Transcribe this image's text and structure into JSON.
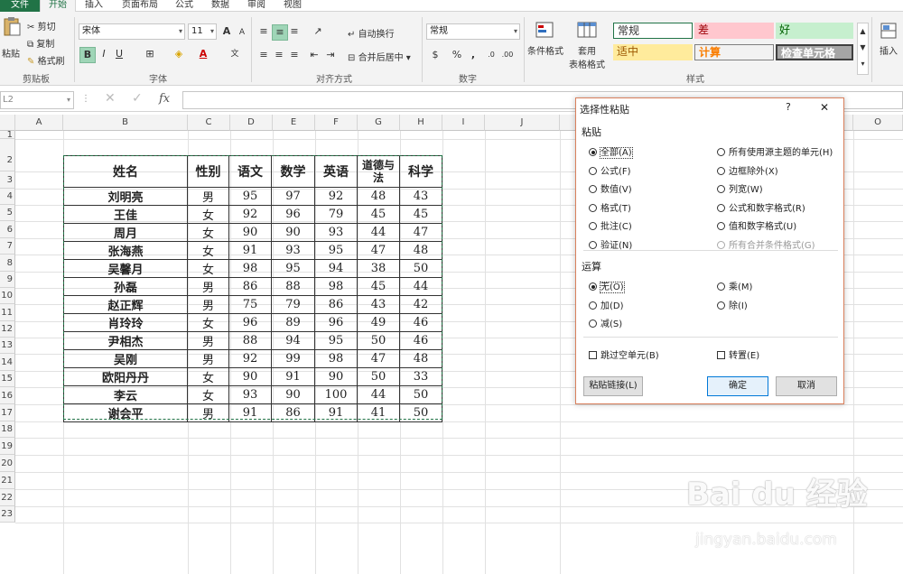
{
  "tabs": [
    "文件",
    "开始",
    "插入",
    "页面布局",
    "公式",
    "数据",
    "审阅",
    "视图"
  ],
  "clipboard": {
    "paste": "粘贴",
    "cut": "剪切",
    "copy": "复制",
    "format_painter": "格式刷",
    "label": "剪贴板"
  },
  "font": {
    "name": "宋体",
    "size": "11",
    "bold": "B",
    "italic": "I",
    "underline": "U",
    "label": "字体",
    "grow": "A",
    "shrink": "A"
  },
  "alignment": {
    "wrap": "自动换行",
    "merge": "合并后居中",
    "label": "对齐方式"
  },
  "number": {
    "format": "常规",
    "percent": "%",
    "comma": ",",
    "label": "数字"
  },
  "styles": {
    "cond_format": "条件格式",
    "table_format_1": "套用",
    "table_format_2": "表格格式",
    "normal": "常规",
    "bad": "差",
    "good": "好",
    "neutral": "适中",
    "calc": "计算",
    "check": "检查单元格",
    "label": "样式"
  },
  "cells": {
    "insert": "插入"
  },
  "formula_bar": {
    "name_box": "L2",
    "fx": "fx"
  },
  "columns": [
    "A",
    "B",
    "C",
    "D",
    "E",
    "F",
    "G",
    "H",
    "I",
    "J",
    "O"
  ],
  "rows": [
    "1",
    "2",
    "3",
    "4",
    "5",
    "6",
    "7",
    "8",
    "9",
    "10",
    "11",
    "12",
    "13",
    "14",
    "15",
    "16",
    "17",
    "18",
    "19",
    "20",
    "21",
    "22",
    "23"
  ],
  "table": {
    "headers": [
      "姓名",
      "性别",
      "语文",
      "数学",
      "英语",
      "道德与法",
      "科学"
    ],
    "rows": [
      [
        "刘明亮",
        "男",
        "95",
        "97",
        "92",
        "48",
        "43"
      ],
      [
        "王佳",
        "女",
        "92",
        "96",
        "79",
        "45",
        "45"
      ],
      [
        "周月",
        "女",
        "90",
        "90",
        "93",
        "44",
        "47"
      ],
      [
        "张海燕",
        "女",
        "91",
        "93",
        "95",
        "47",
        "48"
      ],
      [
        "吴馨月",
        "女",
        "98",
        "95",
        "94",
        "38",
        "50"
      ],
      [
        "孙磊",
        "男",
        "86",
        "88",
        "98",
        "45",
        "44"
      ],
      [
        "赵正辉",
        "男",
        "75",
        "79",
        "86",
        "43",
        "42"
      ],
      [
        "肖玲玲",
        "女",
        "96",
        "89",
        "96",
        "49",
        "46"
      ],
      [
        "尹相杰",
        "男",
        "88",
        "94",
        "95",
        "50",
        "46"
      ],
      [
        "吴刚",
        "男",
        "92",
        "99",
        "98",
        "47",
        "48"
      ],
      [
        "欧阳丹丹",
        "女",
        "90",
        "91",
        "90",
        "50",
        "33"
      ],
      [
        "李云",
        "女",
        "93",
        "90",
        "100",
        "44",
        "50"
      ],
      [
        "谢会平",
        "男",
        "91",
        "86",
        "91",
        "41",
        "50"
      ]
    ]
  },
  "dialog": {
    "title": "选择性粘贴",
    "help": "?",
    "close": "✕",
    "paste_section": "粘贴",
    "paste_left": [
      "全部(A)",
      "公式(F)",
      "数值(V)",
      "格式(T)",
      "批注(C)",
      "验证(N)"
    ],
    "paste_right": [
      "所有使用源主题的单元(H)",
      "边框除外(X)",
      "列宽(W)",
      "公式和数字格式(R)",
      "值和数字格式(U)",
      "所有合并条件格式(G)"
    ],
    "op_section": "运算",
    "op_left": [
      "无(O)",
      "加(D)",
      "减(S)"
    ],
    "op_right": [
      "乘(M)",
      "除(I)"
    ],
    "skip_blanks": "跳过空单元(B)",
    "transpose": "转置(E)",
    "paste_link": "粘贴链接(L)",
    "ok": "确定",
    "cancel": "取消"
  },
  "watermark": {
    "main": "Bai du 经验",
    "sub": "jingyan.baidu.com"
  }
}
